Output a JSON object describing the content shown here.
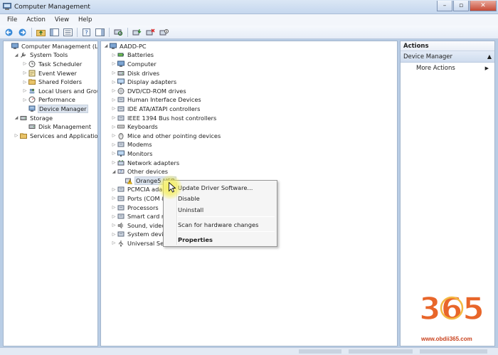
{
  "window": {
    "title": "Computer Management",
    "controls": [
      "minimize-icon",
      "maximize-icon",
      "close-icon"
    ]
  },
  "menu": [
    "File",
    "Action",
    "View",
    "Help"
  ],
  "left_tree": [
    {
      "label": "Computer Management (Local",
      "icon": "computer-management-icon",
      "twisty": "",
      "indent": 0
    },
    {
      "label": "System Tools",
      "icon": "tools-icon",
      "twisty": "◢",
      "indent": 1
    },
    {
      "label": "Task Scheduler",
      "icon": "clock-icon",
      "twisty": "▷",
      "indent": 2
    },
    {
      "label": "Event Viewer",
      "icon": "event-viewer-icon",
      "twisty": "▷",
      "indent": 2
    },
    {
      "label": "Shared Folders",
      "icon": "shared-folder-icon",
      "twisty": "▷",
      "indent": 2
    },
    {
      "label": "Local Users and Groups",
      "icon": "users-icon",
      "twisty": "▷",
      "indent": 2
    },
    {
      "label": "Performance",
      "icon": "performance-icon",
      "twisty": "▷",
      "indent": 2
    },
    {
      "label": "Device Manager",
      "icon": "device-manager-icon",
      "twisty": "",
      "indent": 2,
      "selected": true
    },
    {
      "label": "Storage",
      "icon": "storage-icon",
      "twisty": "◢",
      "indent": 1
    },
    {
      "label": "Disk Management",
      "icon": "disk-icon",
      "twisty": "",
      "indent": 2
    },
    {
      "label": "Services and Applications",
      "icon": "services-icon",
      "twisty": "▷",
      "indent": 1
    }
  ],
  "device_tree": [
    {
      "label": "AADD-PC",
      "icon": "computer-icon",
      "twisty": "◢",
      "indent": 0
    },
    {
      "label": "Batteries",
      "icon": "battery-icon",
      "twisty": "▷",
      "indent": 1
    },
    {
      "label": "Computer",
      "icon": "computer-icon",
      "twisty": "▷",
      "indent": 1
    },
    {
      "label": "Disk drives",
      "icon": "disk-drive-icon",
      "twisty": "▷",
      "indent": 1
    },
    {
      "label": "Display adapters",
      "icon": "display-icon",
      "twisty": "▷",
      "indent": 1
    },
    {
      "label": "DVD/CD-ROM drives",
      "icon": "dvd-icon",
      "twisty": "▷",
      "indent": 1
    },
    {
      "label": "Human Interface Devices",
      "icon": "hid-icon",
      "twisty": "▷",
      "indent": 1
    },
    {
      "label": "IDE ATA/ATAPI controllers",
      "icon": "ide-icon",
      "twisty": "▷",
      "indent": 1
    },
    {
      "label": "IEEE 1394 Bus host controllers",
      "icon": "firewire-icon",
      "twisty": "▷",
      "indent": 1
    },
    {
      "label": "Keyboards",
      "icon": "keyboard-icon",
      "twisty": "▷",
      "indent": 1
    },
    {
      "label": "Mice and other pointing devices",
      "icon": "mouse-icon",
      "twisty": "▷",
      "indent": 1
    },
    {
      "label": "Modems",
      "icon": "modem-icon",
      "twisty": "▷",
      "indent": 1
    },
    {
      "label": "Monitors",
      "icon": "monitor-icon",
      "twisty": "▷",
      "indent": 1
    },
    {
      "label": "Network adapters",
      "icon": "network-icon",
      "twisty": "▷",
      "indent": 1
    },
    {
      "label": "Other devices",
      "icon": "other-devices-icon",
      "twisty": "◢",
      "indent": 1
    },
    {
      "label": "Orange5 USB",
      "icon": "warning-device-icon",
      "twisty": "",
      "indent": 2,
      "selected": true
    },
    {
      "label": "PCMCIA adapters",
      "icon": "pcmcia-icon",
      "twisty": "▷",
      "indent": 1
    },
    {
      "label": "Ports (COM & LPT)",
      "icon": "port-icon",
      "twisty": "▷",
      "indent": 1
    },
    {
      "label": "Processors",
      "icon": "processor-icon",
      "twisty": "▷",
      "indent": 1
    },
    {
      "label": "Smart card readers",
      "icon": "smart-card-icon",
      "twisty": "▷",
      "indent": 1
    },
    {
      "label": "Sound, video and game controllers",
      "icon": "sound-icon",
      "twisty": "▷",
      "indent": 1
    },
    {
      "label": "System devices",
      "icon": "system-devices-icon",
      "twisty": "▷",
      "indent": 1
    },
    {
      "label": "Universal Serial Bus controllers",
      "icon": "usb-icon",
      "twisty": "▷",
      "indent": 1
    }
  ],
  "context_menu": {
    "update": "Update Driver Software...",
    "disable": "Disable",
    "uninstall": "Uninstall",
    "scan": "Scan for hardware changes",
    "properties": "Properties"
  },
  "actions": {
    "header": "Actions",
    "section": "Device Manager",
    "more": "More Actions"
  },
  "watermark": {
    "logo_text": "365",
    "url": "www.obdii365.com"
  },
  "colors": {
    "frame": "#b9cde5",
    "selection": "#dbe3ee",
    "accent_orange": "#e8662a"
  }
}
